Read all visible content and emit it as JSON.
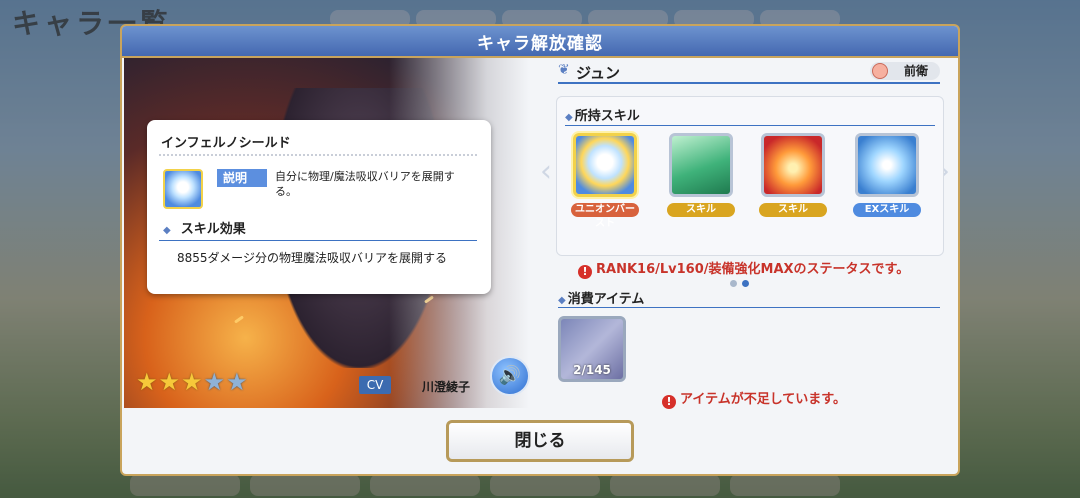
{
  "background": {
    "title": "キャラ一覧"
  },
  "dialog": {
    "title": "キャラ解放確認",
    "close_label": "閉じる"
  },
  "character": {
    "name": "ジュン",
    "position": "前衛",
    "stars_total": 5,
    "stars_filled": 3,
    "cv_label": "CV",
    "cv_name": "川澄綾子"
  },
  "skills": {
    "section_title": "所持スキル",
    "items": [
      {
        "tag": "ユニオンバースト",
        "color": "#d8623d",
        "icon": "shield-burst-icon",
        "selected": true
      },
      {
        "tag": "スキル",
        "color": "#d9a520",
        "icon": "sword-plant-icon"
      },
      {
        "tag": "スキル",
        "color": "#d9a520",
        "icon": "fire-sword-icon"
      },
      {
        "tag": "EXスキル",
        "color": "#4f8be0",
        "icon": "ice-shard-icon"
      }
    ],
    "status_note": "RANK16/Lv160/装備強化MAXのステータスです。"
  },
  "consume": {
    "section_title": "消費アイテム",
    "item_count": "2/145",
    "warning": "アイテムが不足しています。"
  },
  "tooltip": {
    "title": "インフェルノシールド",
    "desc_label": "説明",
    "desc": "自分に物理/魔法吸収バリアを展開する。",
    "effect_label": "スキル効果",
    "effect": "8855ダメージ分の物理魔法吸収バリアを展開する"
  }
}
